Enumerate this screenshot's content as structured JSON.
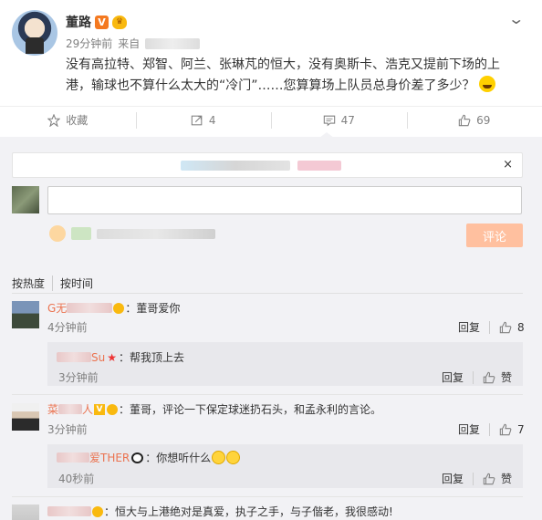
{
  "post": {
    "author": "董路",
    "time": "29分钟前",
    "source_prefix": "来自",
    "text": "没有高拉特、郑智、阿兰、张琳芃的恒大，没有奥斯卡、浩克又提前下场的上港，输球也不算什么太大的“冷门”……您算算场上队员总身价差了多少？"
  },
  "actions": {
    "favorite_label": "收藏",
    "repost_count": "4",
    "comment_count": "47",
    "like_count": "69"
  },
  "composer": {
    "submit_label": "评论",
    "close_symbol": "×"
  },
  "sort": {
    "by_heat": "按热度",
    "by_time": "按时间"
  },
  "comments": [
    {
      "name_visible": "G无",
      "text": "：董哥爱你",
      "time": "4分钟前",
      "reply_label": "回复",
      "like_count": "8",
      "reply": {
        "name_visible": "Su",
        "text": "：帮我顶上去",
        "time": "3分钟前",
        "reply_label": "回复",
        "like_label": "赞"
      }
    },
    {
      "name_visible_a": "菜",
      "name_visible_b": "人",
      "text": "：董哥，评论一下保定球迷扔石头，和孟永利的言论。",
      "time": "3分钟前",
      "reply_label": "回复",
      "like_count": "7",
      "reply": {
        "name_visible": "爱THER",
        "text": "：你想听什么",
        "time": "40秒前",
        "reply_label": "回复",
        "like_label": "赞"
      }
    },
    {
      "text": "：恒大与上港绝对是真爱，执子之手，与子偕老，我很感动!"
    }
  ],
  "colors": {
    "name": "#eb7350",
    "submit_bg": "#ffc09f",
    "panel_bg": "#f2f2f5",
    "reply_bg": "#e8e8ec"
  }
}
